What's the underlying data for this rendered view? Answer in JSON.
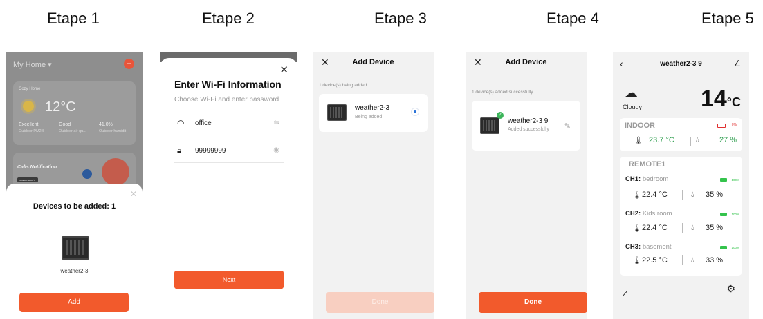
{
  "steps": [
    "Etape 1",
    "Etape 2",
    "Etape 3",
    "Etape 4",
    "Etape 5"
  ],
  "screen1": {
    "home_title": "My Home ▾",
    "plus": "+",
    "cozy": "Cozy Home",
    "temp": "12°C",
    "stats": [
      {
        "label": "Excellent",
        "sub": "Outdoor PM2.5"
      },
      {
        "label": "Good",
        "sub": "Outdoor air qu..."
      },
      {
        "label": "41.0%",
        "sub": "Outdoor humidit"
      }
    ],
    "notif_title": "Calls Notification",
    "learn_more": "Learn more >",
    "sheet_title": "Devices to be added: 1",
    "device_name": "weather2-3",
    "add_label": "Add"
  },
  "screen2": {
    "title": "Enter Wi-Fi Information",
    "subtitle": "Choose Wi-Fi and enter password",
    "wifi_name": "office",
    "password": "99999999",
    "next_label": "Next"
  },
  "screen3": {
    "title": "Add Device",
    "status": "1 device(s) being added",
    "device_name": "weather2-3",
    "device_status": "Being added",
    "done_label": "Done"
  },
  "screen4": {
    "title": "Add Device",
    "status": "1 device(s) added successfully",
    "device_name": "weather2-3 9",
    "device_status": "Added successfully",
    "done_label": "Done"
  },
  "screen5": {
    "title": "weather2-3 9",
    "condition": "Cloudy",
    "temp": "14",
    "temp_unit": "°C",
    "indoor": {
      "label": "INDOOR",
      "battery": "0%",
      "temp": "23.7 °C",
      "humidity": "27 %"
    },
    "remote_label": "REMOTE1",
    "channels": [
      {
        "ch": "CH1:",
        "name": "bedroom",
        "battery": "100%",
        "temp": "22.4 °C",
        "humidity": "35 %"
      },
      {
        "ch": "CH2:",
        "name": "Kids room",
        "battery": "100%",
        "temp": "22.4 °C",
        "humidity": "35 %"
      },
      {
        "ch": "CH3:",
        "name": "basement",
        "battery": "100%",
        "temp": "22.5 °C",
        "humidity": "33 %"
      }
    ]
  },
  "colors": {
    "accent": "#f25a2c",
    "green": "#2e9e4e",
    "battery_green": "#34c34c",
    "battery_red": "#e03030"
  }
}
